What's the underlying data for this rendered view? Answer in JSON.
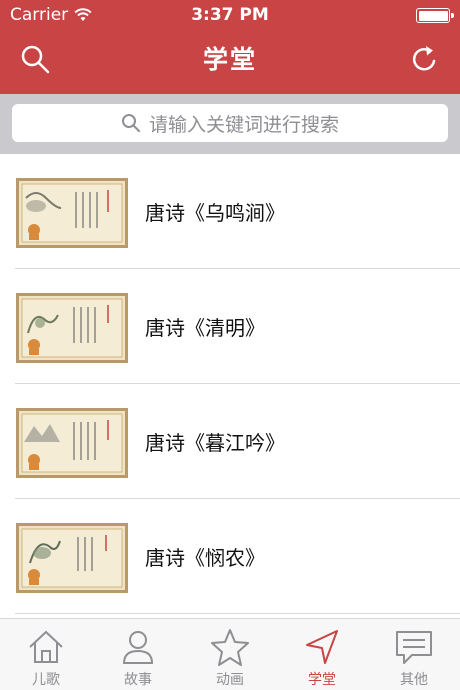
{
  "status": {
    "carrier": "Carrier",
    "time": "3:37 PM"
  },
  "nav": {
    "title": "学堂",
    "search_icon": "search-icon",
    "refresh_icon": "refresh-icon"
  },
  "search": {
    "placeholder": "请输入关键词进行搜索"
  },
  "list": [
    {
      "title": "唐诗《乌鸣涧》",
      "thumb": "poem-scroll-thumbnail"
    },
    {
      "title": "唐诗《清明》",
      "thumb": "poem-scroll-thumbnail"
    },
    {
      "title": "唐诗《暮江吟》",
      "thumb": "poem-scroll-thumbnail"
    },
    {
      "title": "唐诗《悯农》",
      "thumb": "poem-scroll-thumbnail"
    }
  ],
  "tabs": [
    {
      "label": "儿歌",
      "icon": "home-icon",
      "active": false
    },
    {
      "label": "故事",
      "icon": "person-icon",
      "active": false
    },
    {
      "label": "动画",
      "icon": "star-icon",
      "active": false
    },
    {
      "label": "学堂",
      "icon": "navigation-arrow-icon",
      "active": true
    },
    {
      "label": "其他",
      "icon": "chat-bubble-icon",
      "active": false
    }
  ],
  "colors": {
    "brand": "#c94444",
    "tab_inactive": "#8e8e93"
  }
}
